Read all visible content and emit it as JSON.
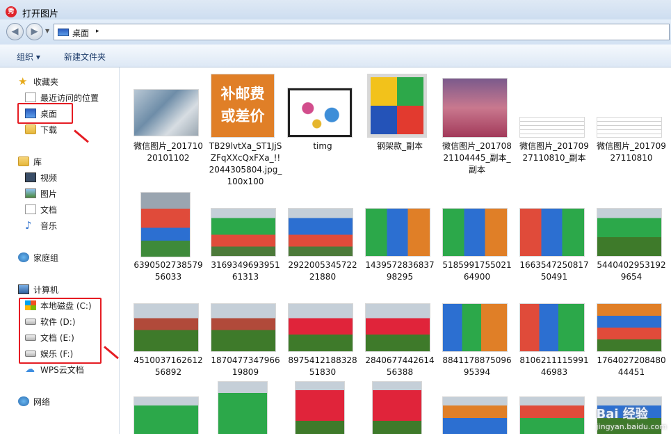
{
  "window": {
    "title": "打开图片",
    "logo_text": "秀"
  },
  "address": {
    "location": "桌面",
    "separator": "▸"
  },
  "toolbar": {
    "organize": "组织 ▾",
    "new_folder": "新建文件夹"
  },
  "sidebar": {
    "favorites": "收藏夹",
    "recent": "最近访问的位置",
    "desktop": "桌面",
    "downloads": "下载",
    "libraries": "库",
    "videos": "视频",
    "pictures": "图片",
    "documents": "文档",
    "music": "音乐",
    "homegroup": "家庭组",
    "computer": "计算机",
    "drive_c": "本地磁盘 (C:)",
    "drive_d": "软件 (D:)",
    "drive_e": "文档 (E:)",
    "drive_f": "娱乐 (F:)",
    "wps": "WPS云文档",
    "network": "网络"
  },
  "files": {
    "f0": "微信图片_20171020101102",
    "f1": "TB29lvtXa_ST1JjSZFqXXcQxFXa_!!2044305804.jpg_100x100",
    "f2": "timg",
    "f3": "钢架款_副本",
    "f4": "微信图片_20170821104445_副本_副本",
    "f5": "微信图片_20170927110810_副本",
    "f6": "微信图片_20170927110810",
    "f7": "639050273857956033",
    "f8": "316934969395161313",
    "f9": "292200534572221880",
    "f10": "143957283683798295",
    "f11": "518599175502164900",
    "f12": "166354725081750491",
    "f13": "54404029531929654",
    "f14": "451003716261256892",
    "f15": "187047734796619809",
    "f16": "897541218832851830",
    "f17": "284067744261456388",
    "f18": "884117887509695394",
    "f19": "810621111599146983",
    "f20": "176402720848044451"
  },
  "thumb_text": {
    "t1a": "补邮费",
    "t1b": "或差价"
  },
  "watermark": {
    "brand": "Bai 经验",
    "url": "jingyan.baidu.com"
  }
}
